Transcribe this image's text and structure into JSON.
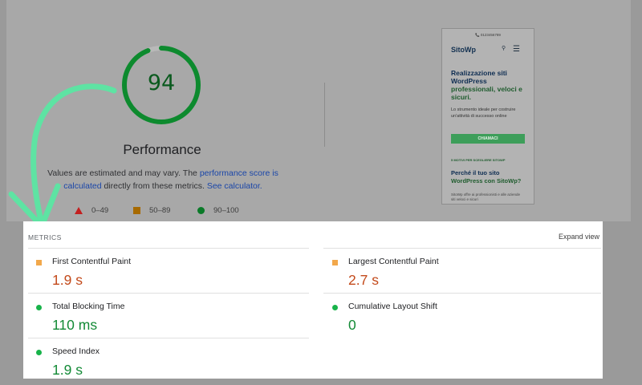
{
  "performance": {
    "score": "94",
    "score_fraction": 0.94,
    "title": "Performance",
    "desc_pre": "Values are estimated and may vary. The ",
    "desc_link1": "performance score is calculated",
    "desc_mid": " directly from these metrics. ",
    "desc_link2": "See calculator.",
    "legend": [
      {
        "range": "0–49",
        "shape": "triangle"
      },
      {
        "range": "50–89",
        "shape": "square"
      },
      {
        "range": "90–100",
        "shape": "circle"
      }
    ]
  },
  "preview": {
    "phone_line": "📞 0123456789",
    "logo": "SitoWp",
    "headline_1": "Realizzazione siti WordPress",
    "headline_2": "professionali, veloci e sicuri.",
    "sub": "Lo strumento ideale per costruire un'attività di successo online",
    "cta": "CHIAMACI",
    "small": "5 MOTIVI PER SCEGLIERE SITOWP",
    "h2_1": "Perché il tuo sito",
    "h2_2": "WordPress con SitoWp?",
    "body": "SitoWp offre ai professionisti e alle aziende siti veloci e sicuri"
  },
  "metrics": {
    "section_label": "METRICS",
    "expand_label": "Expand view",
    "items": [
      {
        "name": "First Contentful Paint",
        "value": "1.9 s",
        "rating": "avg"
      },
      {
        "name": "Largest Contentful Paint",
        "value": "2.7 s",
        "rating": "avg"
      },
      {
        "name": "Total Blocking Time",
        "value": "110 ms",
        "rating": "good"
      },
      {
        "name": "Cumulative Layout Shift",
        "value": "0",
        "rating": "good"
      },
      {
        "name": "Speed Index",
        "value": "1.9 s",
        "rating": "good"
      }
    ]
  },
  "colors": {
    "good": "#18b34a",
    "average": "#f2a84b",
    "poor": "#c31f1f",
    "arrow": "#5ee3a3"
  }
}
